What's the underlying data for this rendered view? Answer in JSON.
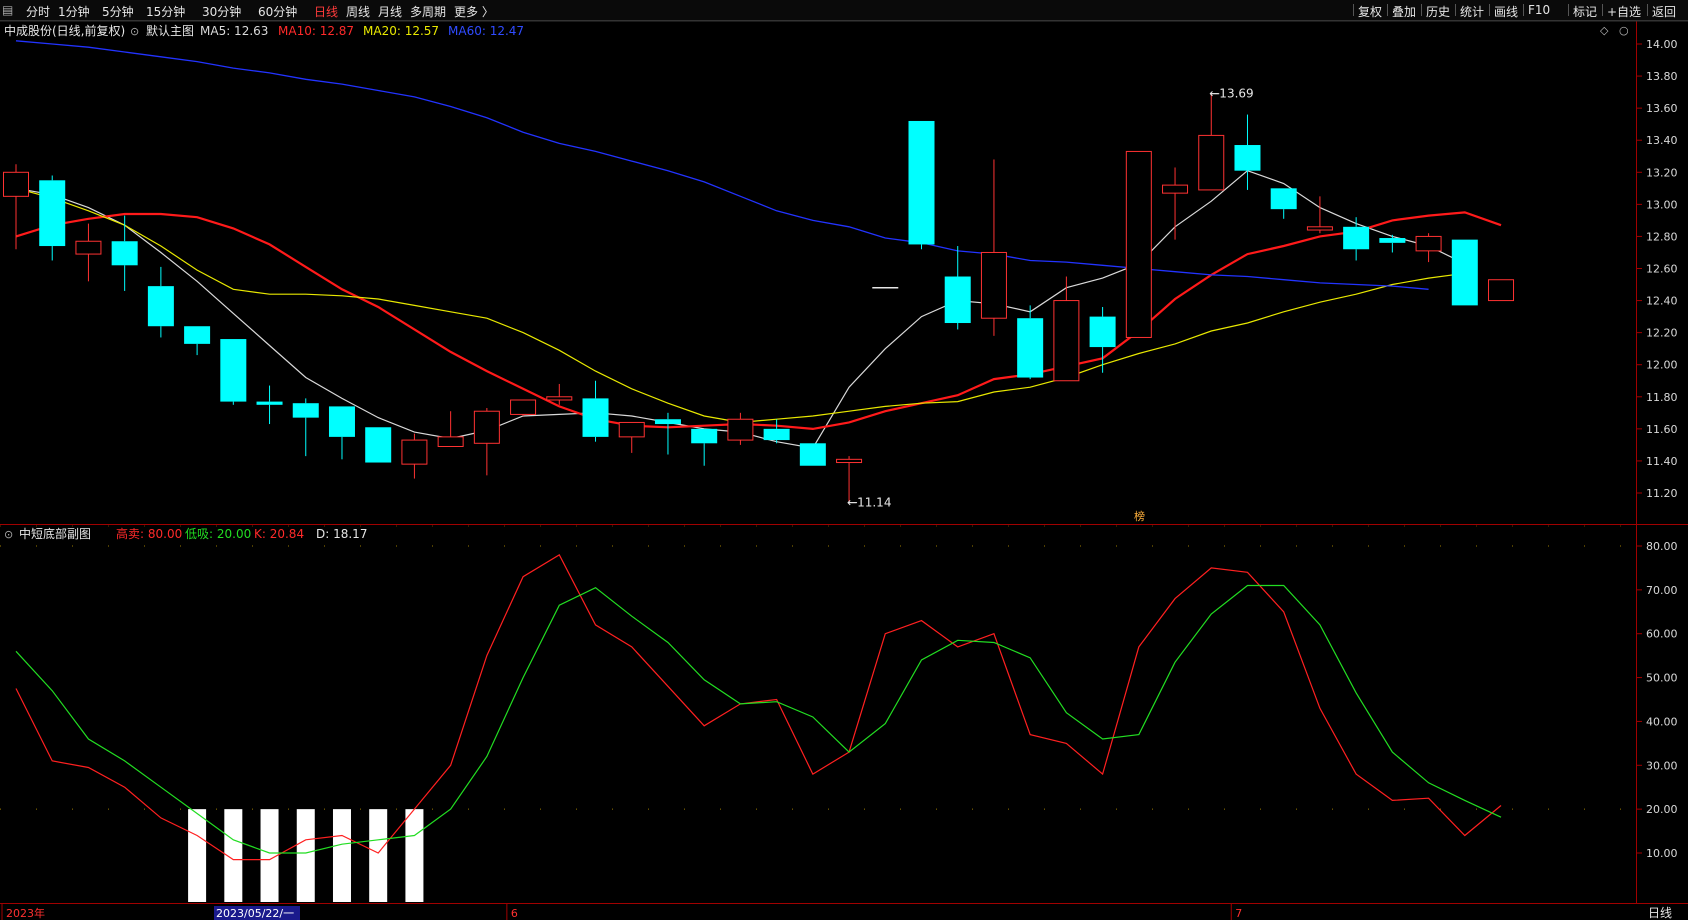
{
  "toolbar": {
    "left_items": [
      {
        "label": "分时",
        "active": false
      },
      {
        "label": "1分钟",
        "active": false
      },
      {
        "label": "5分钟",
        "active": false
      },
      {
        "label": "15分钟",
        "active": false
      },
      {
        "label": "30分钟",
        "active": false
      },
      {
        "label": "60分钟",
        "active": false
      },
      {
        "label": "日线",
        "active": true
      },
      {
        "label": "周线",
        "active": false
      },
      {
        "label": "月线",
        "active": false
      },
      {
        "label": "多周期",
        "active": false
      },
      {
        "label": "更多 〉",
        "active": false
      }
    ],
    "right_items": [
      "复权",
      "叠加",
      "历史",
      "统计",
      "画线",
      "F10",
      "标记",
      "+自选",
      "返回"
    ]
  },
  "main_panel": {
    "security_label": "中成股份(日线,前复权)",
    "template_label": "默认主图",
    "ma_labels": [
      {
        "text": "MA5: 12.63",
        "color": "#d9d9d9"
      },
      {
        "text": "MA10: 12.87",
        "color": "#ff2a2a"
      },
      {
        "text": "MA20: 12.57",
        "color": "#e8e800"
      },
      {
        "text": "MA60: 12.47",
        "color": "#2f4bff"
      }
    ],
    "marker_text": "榜"
  },
  "sub_panel": {
    "title": "中短底部副图",
    "params": [
      {
        "text": "高卖: 80.00",
        "color": "#ff2a2a"
      },
      {
        "text": "低吸: 20.00",
        "color": "#22dd22"
      },
      {
        "text": "K: 20.84",
        "color": "#ff2a2a"
      },
      {
        "text": "D: 18.17",
        "color": "#e6e6e6"
      }
    ]
  },
  "bottom_axis": {
    "labels": [
      {
        "text": "2023年",
        "at": 0
      },
      {
        "text": "6",
        "at": 13
      },
      {
        "text": "7",
        "at": 33
      }
    ],
    "cursor_label": "2023/05/22/一",
    "period_label": "日线"
  },
  "colors": {
    "up": "#ff3232",
    "down": "#00ffff",
    "ma5": "#d9d9d9",
    "ma10": "#ff1a1a",
    "ma20": "#e8e800",
    "ma60": "#2233ff",
    "k_line": "#ff2020",
    "d_line": "#22dd22",
    "grid": "#8b0000"
  },
  "chart_data": [
    {
      "type": "candlestick",
      "title": "中成股份(日线,前复权)",
      "y_ticks": [
        "14.00",
        "13.80",
        "13.60",
        "13.40",
        "13.20",
        "13.00",
        "12.80",
        "12.60",
        "12.40",
        "12.20",
        "12.00",
        "11.80",
        "11.60",
        "11.40",
        "11.20"
      ],
      "ylim": [
        11.06,
        14.06
      ],
      "annotations": [
        {
          "text": "13.69",
          "index": 33,
          "value": 13.69
        },
        {
          "text": "11.14",
          "index": 23,
          "value": 11.14
        }
      ],
      "candles": [
        {
          "o": 13.05,
          "h": 13.25,
          "l": 12.72,
          "c": 13.2
        },
        {
          "o": 13.15,
          "h": 13.18,
          "l": 12.65,
          "c": 12.74
        },
        {
          "o": 12.69,
          "h": 12.88,
          "l": 12.52,
          "c": 12.77
        },
        {
          "o": 12.77,
          "h": 12.93,
          "l": 12.46,
          "c": 12.62
        },
        {
          "o": 12.49,
          "h": 12.61,
          "l": 12.17,
          "c": 12.24
        },
        {
          "o": 12.24,
          "h": 12.24,
          "l": 12.06,
          "c": 12.13
        },
        {
          "o": 12.16,
          "h": 12.16,
          "l": 11.75,
          "c": 11.77
        },
        {
          "o": 11.77,
          "h": 11.87,
          "l": 11.63,
          "c": 11.75
        },
        {
          "o": 11.76,
          "h": 11.79,
          "l": 11.43,
          "c": 11.67
        },
        {
          "o": 11.74,
          "h": 11.74,
          "l": 11.41,
          "c": 11.55
        },
        {
          "o": 11.61,
          "h": 11.61,
          "l": 11.39,
          "c": 11.39
        },
        {
          "o": 11.38,
          "h": 11.57,
          "l": 11.29,
          "c": 11.53
        },
        {
          "o": 11.49,
          "h": 11.71,
          "l": 11.49,
          "c": 11.55
        },
        {
          "o": 11.51,
          "h": 11.73,
          "l": 11.31,
          "c": 11.71
        },
        {
          "o": 11.69,
          "h": 11.78,
          "l": 11.68,
          "c": 11.78
        },
        {
          "o": 11.78,
          "h": 11.88,
          "l": 11.75,
          "c": 11.8
        },
        {
          "o": 11.79,
          "h": 11.9,
          "l": 11.52,
          "c": 11.55
        },
        {
          "o": 11.55,
          "h": 11.64,
          "l": 11.45,
          "c": 11.64
        },
        {
          "o": 11.66,
          "h": 11.7,
          "l": 11.44,
          "c": 11.63
        },
        {
          "o": 11.6,
          "h": 11.6,
          "l": 11.37,
          "c": 11.51
        },
        {
          "o": 11.53,
          "h": 11.7,
          "l": 11.5,
          "c": 11.66
        },
        {
          "o": 11.6,
          "h": 11.66,
          "l": 11.51,
          "c": 11.53
        },
        {
          "o": 11.51,
          "h": 11.51,
          "l": 11.37,
          "c": 11.37
        },
        {
          "o": 11.39,
          "h": 11.43,
          "l": 11.14,
          "c": 11.41
        },
        {
          "o": 12.48,
          "h": 12.48,
          "l": 12.48,
          "c": 12.48
        },
        {
          "o": 13.52,
          "h": 13.52,
          "l": 12.72,
          "c": 12.75
        },
        {
          "o": 12.55,
          "h": 12.74,
          "l": 12.22,
          "c": 12.26
        },
        {
          "o": 12.29,
          "h": 13.28,
          "l": 12.18,
          "c": 12.7
        },
        {
          "o": 12.29,
          "h": 12.37,
          "l": 11.91,
          "c": 11.92
        },
        {
          "o": 11.9,
          "h": 12.55,
          "l": 11.9,
          "c": 12.4
        },
        {
          "o": 12.3,
          "h": 12.36,
          "l": 11.95,
          "c": 12.11
        },
        {
          "o": 12.17,
          "h": 13.33,
          "l": 12.17,
          "c": 13.33
        },
        {
          "o": 13.07,
          "h": 13.23,
          "l": 12.78,
          "c": 13.12
        },
        {
          "o": 13.09,
          "h": 13.69,
          "l": 13.09,
          "c": 13.43
        },
        {
          "o": 13.37,
          "h": 13.56,
          "l": 13.09,
          "c": 13.21
        },
        {
          "o": 13.1,
          "h": 13.1,
          "l": 12.91,
          "c": 12.97
        },
        {
          "o": 12.84,
          "h": 13.05,
          "l": 12.82,
          "c": 12.86
        },
        {
          "o": 12.86,
          "h": 12.92,
          "l": 12.65,
          "c": 12.72
        },
        {
          "o": 12.79,
          "h": 12.81,
          "l": 12.7,
          "c": 12.76
        },
        {
          "o": 12.71,
          "h": 12.82,
          "l": 12.64,
          "c": 12.8
        },
        {
          "o": 12.78,
          "h": 12.78,
          "l": 12.37,
          "c": 12.37
        },
        {
          "o": 12.4,
          "h": 12.53,
          "l": 12.4,
          "c": 12.53
        }
      ],
      "series": [
        {
          "name": "MA5",
          "values": [
            13.1,
            13.06,
            12.98,
            12.87,
            12.7,
            12.52,
            12.32,
            12.12,
            11.92,
            11.79,
            11.67,
            11.58,
            11.54,
            11.59,
            11.68,
            11.69,
            11.7,
            11.68,
            11.64,
            11.6,
            11.58,
            11.52,
            11.48,
            11.86,
            12.1,
            12.3,
            12.4,
            12.38,
            12.33,
            12.48,
            12.54,
            12.63,
            12.86,
            13.02,
            13.21,
            13.13,
            12.98,
            12.88,
            12.8,
            12.74,
            12.63
          ]
        },
        {
          "name": "MA10",
          "values": [
            12.8,
            12.87,
            12.91,
            12.94,
            12.94,
            12.92,
            12.85,
            12.75,
            12.61,
            12.47,
            12.36,
            12.22,
            12.08,
            11.96,
            11.85,
            11.74,
            11.66,
            11.62,
            11.61,
            11.62,
            11.63,
            11.62,
            11.6,
            11.64,
            11.71,
            11.76,
            11.81,
            11.91,
            11.94,
            11.99,
            12.04,
            12.21,
            12.41,
            12.56,
            12.69,
            12.74,
            12.8,
            12.83,
            12.9,
            12.93,
            12.95,
            12.87
          ]
        },
        {
          "name": "MA20",
          "values": [
            13.1,
            13.04,
            12.96,
            12.87,
            12.74,
            12.59,
            12.47,
            12.44,
            12.44,
            12.43,
            12.41,
            12.37,
            12.33,
            12.29,
            12.2,
            12.09,
            11.96,
            11.85,
            11.76,
            11.68,
            11.64,
            11.66,
            11.68,
            11.71,
            11.74,
            11.76,
            11.77,
            11.83,
            11.86,
            11.92,
            12.0,
            12.07,
            12.13,
            12.21,
            12.26,
            12.33,
            12.39,
            12.44,
            12.5,
            12.54,
            12.57
          ]
        },
        {
          "name": "MA60",
          "values": [
            14.02,
            14.0,
            13.98,
            13.95,
            13.92,
            13.89,
            13.85,
            13.82,
            13.78,
            13.75,
            13.71,
            13.67,
            13.61,
            13.54,
            13.45,
            13.38,
            13.33,
            13.27,
            13.21,
            13.14,
            13.05,
            12.96,
            12.9,
            12.86,
            12.79,
            12.76,
            12.71,
            12.69,
            12.65,
            12.64,
            12.62,
            12.6,
            12.58,
            12.56,
            12.55,
            12.53,
            12.51,
            12.5,
            12.49,
            12.47
          ]
        }
      ]
    },
    {
      "type": "line",
      "title": "中短底部副图",
      "y_ticks": [
        "80.00",
        "70.00",
        "60.00",
        "50.00",
        "40.00",
        "30.00",
        "20.00",
        "10.00"
      ],
      "ylim": [
        0,
        83.4
      ],
      "reference_levels": [
        80,
        20
      ],
      "series": [
        {
          "name": "K",
          "values": [
            47.5,
            31,
            29.5,
            25,
            18,
            14,
            8.5,
            8.5,
            13,
            14,
            10,
            20,
            30,
            55,
            73,
            78,
            62,
            57,
            48,
            39,
            44,
            45,
            28,
            33,
            60,
            63,
            57,
            60,
            37,
            35,
            28,
            57,
            68,
            75,
            74,
            65,
            43,
            28,
            22,
            22.5,
            14,
            20.84
          ]
        },
        {
          "name": "D",
          "values": [
            56,
            47,
            36,
            31,
            25,
            19,
            13,
            10,
            10,
            12,
            13,
            14,
            20,
            32,
            50,
            66.5,
            70.5,
            64,
            58,
            49.5,
            44,
            44.5,
            41,
            33,
            39.5,
            54,
            58.5,
            58,
            54.5,
            42,
            36,
            37,
            53.5,
            64.5,
            71,
            71,
            62,
            46.5,
            33,
            26,
            22,
            18.17
          ]
        }
      ],
      "signal_bars": [
        5,
        6,
        7,
        8,
        9,
        10,
        11
      ]
    }
  ]
}
